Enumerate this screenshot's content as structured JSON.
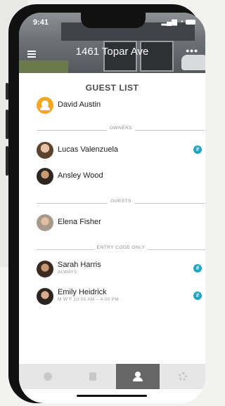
{
  "status": {
    "time": "9:41"
  },
  "header": {
    "title": "1461 Topar Ave"
  },
  "guest_list": {
    "title": "GUEST LIST",
    "owner": {
      "name": "David Austin"
    },
    "sections": [
      {
        "label": "OWNERS",
        "people": [
          {
            "name": "Lucas Valenzuela",
            "badge": "#"
          },
          {
            "name": "Ansley Wood"
          }
        ]
      },
      {
        "label": "GUESTS",
        "people": [
          {
            "name": "Elena Fisher"
          }
        ]
      },
      {
        "label": "ENTRY CODE ONLY",
        "people": [
          {
            "name": "Sarah Harris",
            "schedule": "ALWAYS",
            "badge": "#"
          },
          {
            "name": "Emily Heidrick",
            "schedule": "M W F 10:00 AM – 4:00 PM",
            "badge": "#"
          }
        ]
      }
    ]
  },
  "tabs": [
    {
      "icon": "circle-icon",
      "active": false
    },
    {
      "icon": "list-icon",
      "active": false
    },
    {
      "icon": "guests-icon",
      "active": true
    },
    {
      "icon": "gear-icon",
      "active": false
    }
  ],
  "colors": {
    "accent": "#22a6c3",
    "owner_avatar": "#f5a623",
    "active_tab": "#666666"
  }
}
